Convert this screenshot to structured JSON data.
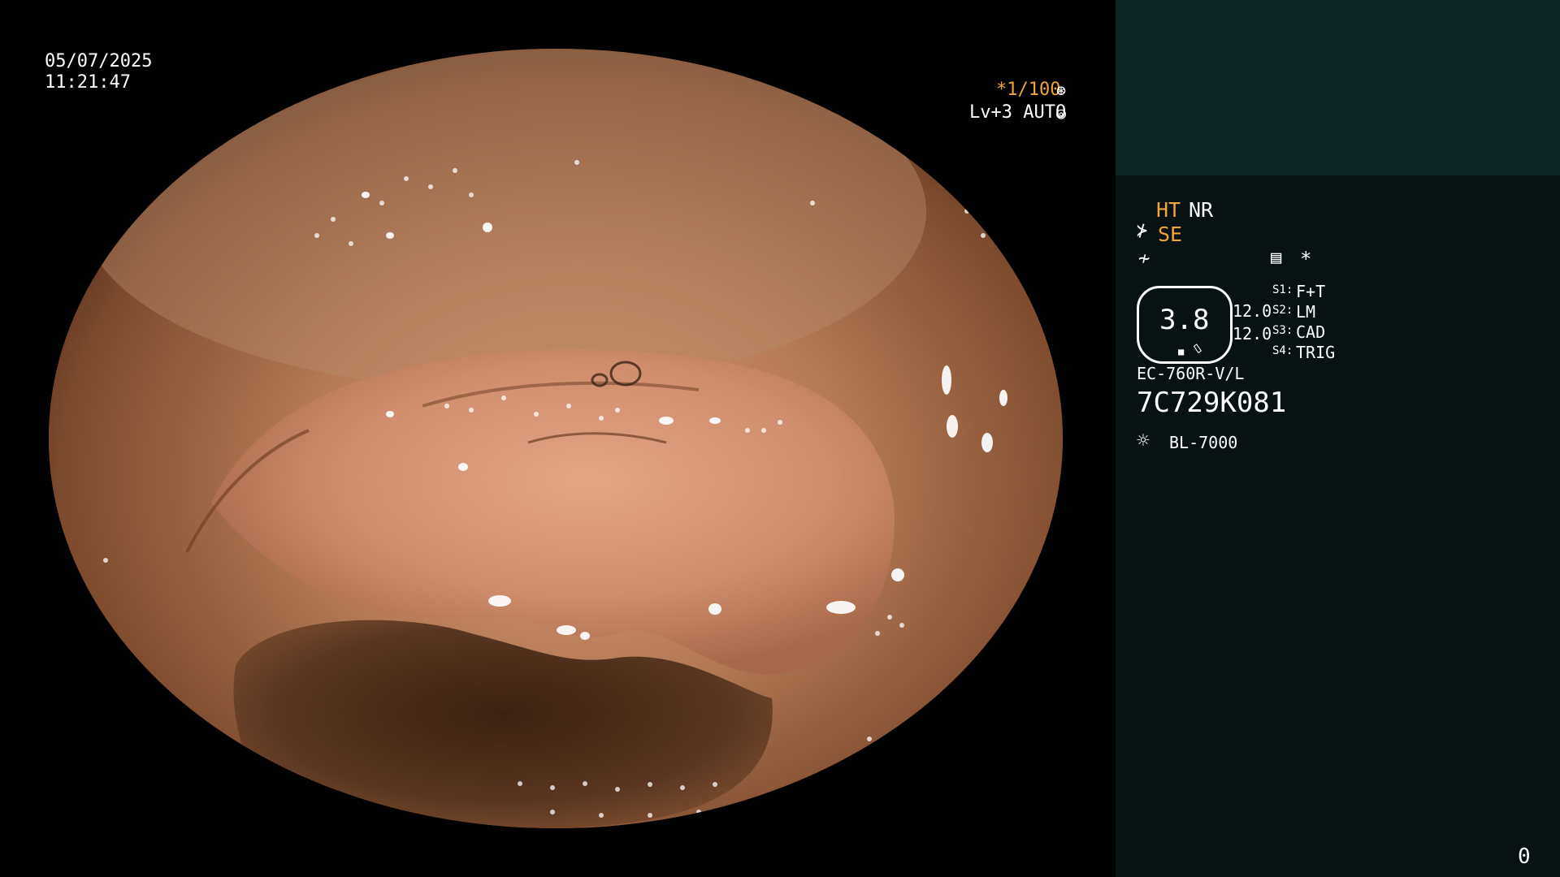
{
  "overlay": {
    "date": "05/07/2025",
    "time": "11:21:47",
    "shutter": "*1/100",
    "shutter_icon": "aperture-icon",
    "iris": "Lv+3 AUTO",
    "iris_icon": "iris-icon"
  },
  "panel": {
    "ht": "HT",
    "nr": "NR",
    "se": "SE",
    "se_icon": "structure-enhance-icon",
    "freeze_icon": "freeze-icon",
    "menu_icon": "settings-list-icon",
    "star": "*",
    "zoom": "3.8",
    "zoom_value_1": "12.0",
    "zoom_value_2": "12.0",
    "switches": [
      {
        "key": "S1:",
        "value": "F+T"
      },
      {
        "key": "S2:",
        "value": "LM"
      },
      {
        "key": "S3:",
        "value": "CAD"
      },
      {
        "key": "S4:",
        "value": "TRIG"
      }
    ],
    "scope_model": "EC-760R-V/L",
    "scope_serial": "7C729K081",
    "light_icon": "light-source-icon",
    "light_source": "BL-7000",
    "counter": "0"
  },
  "colors": {
    "orange_text": "#f0a43a",
    "panel_bg": "#081212",
    "panel_top_bg": "#0e2526",
    "mucosa": "#b57a55"
  }
}
